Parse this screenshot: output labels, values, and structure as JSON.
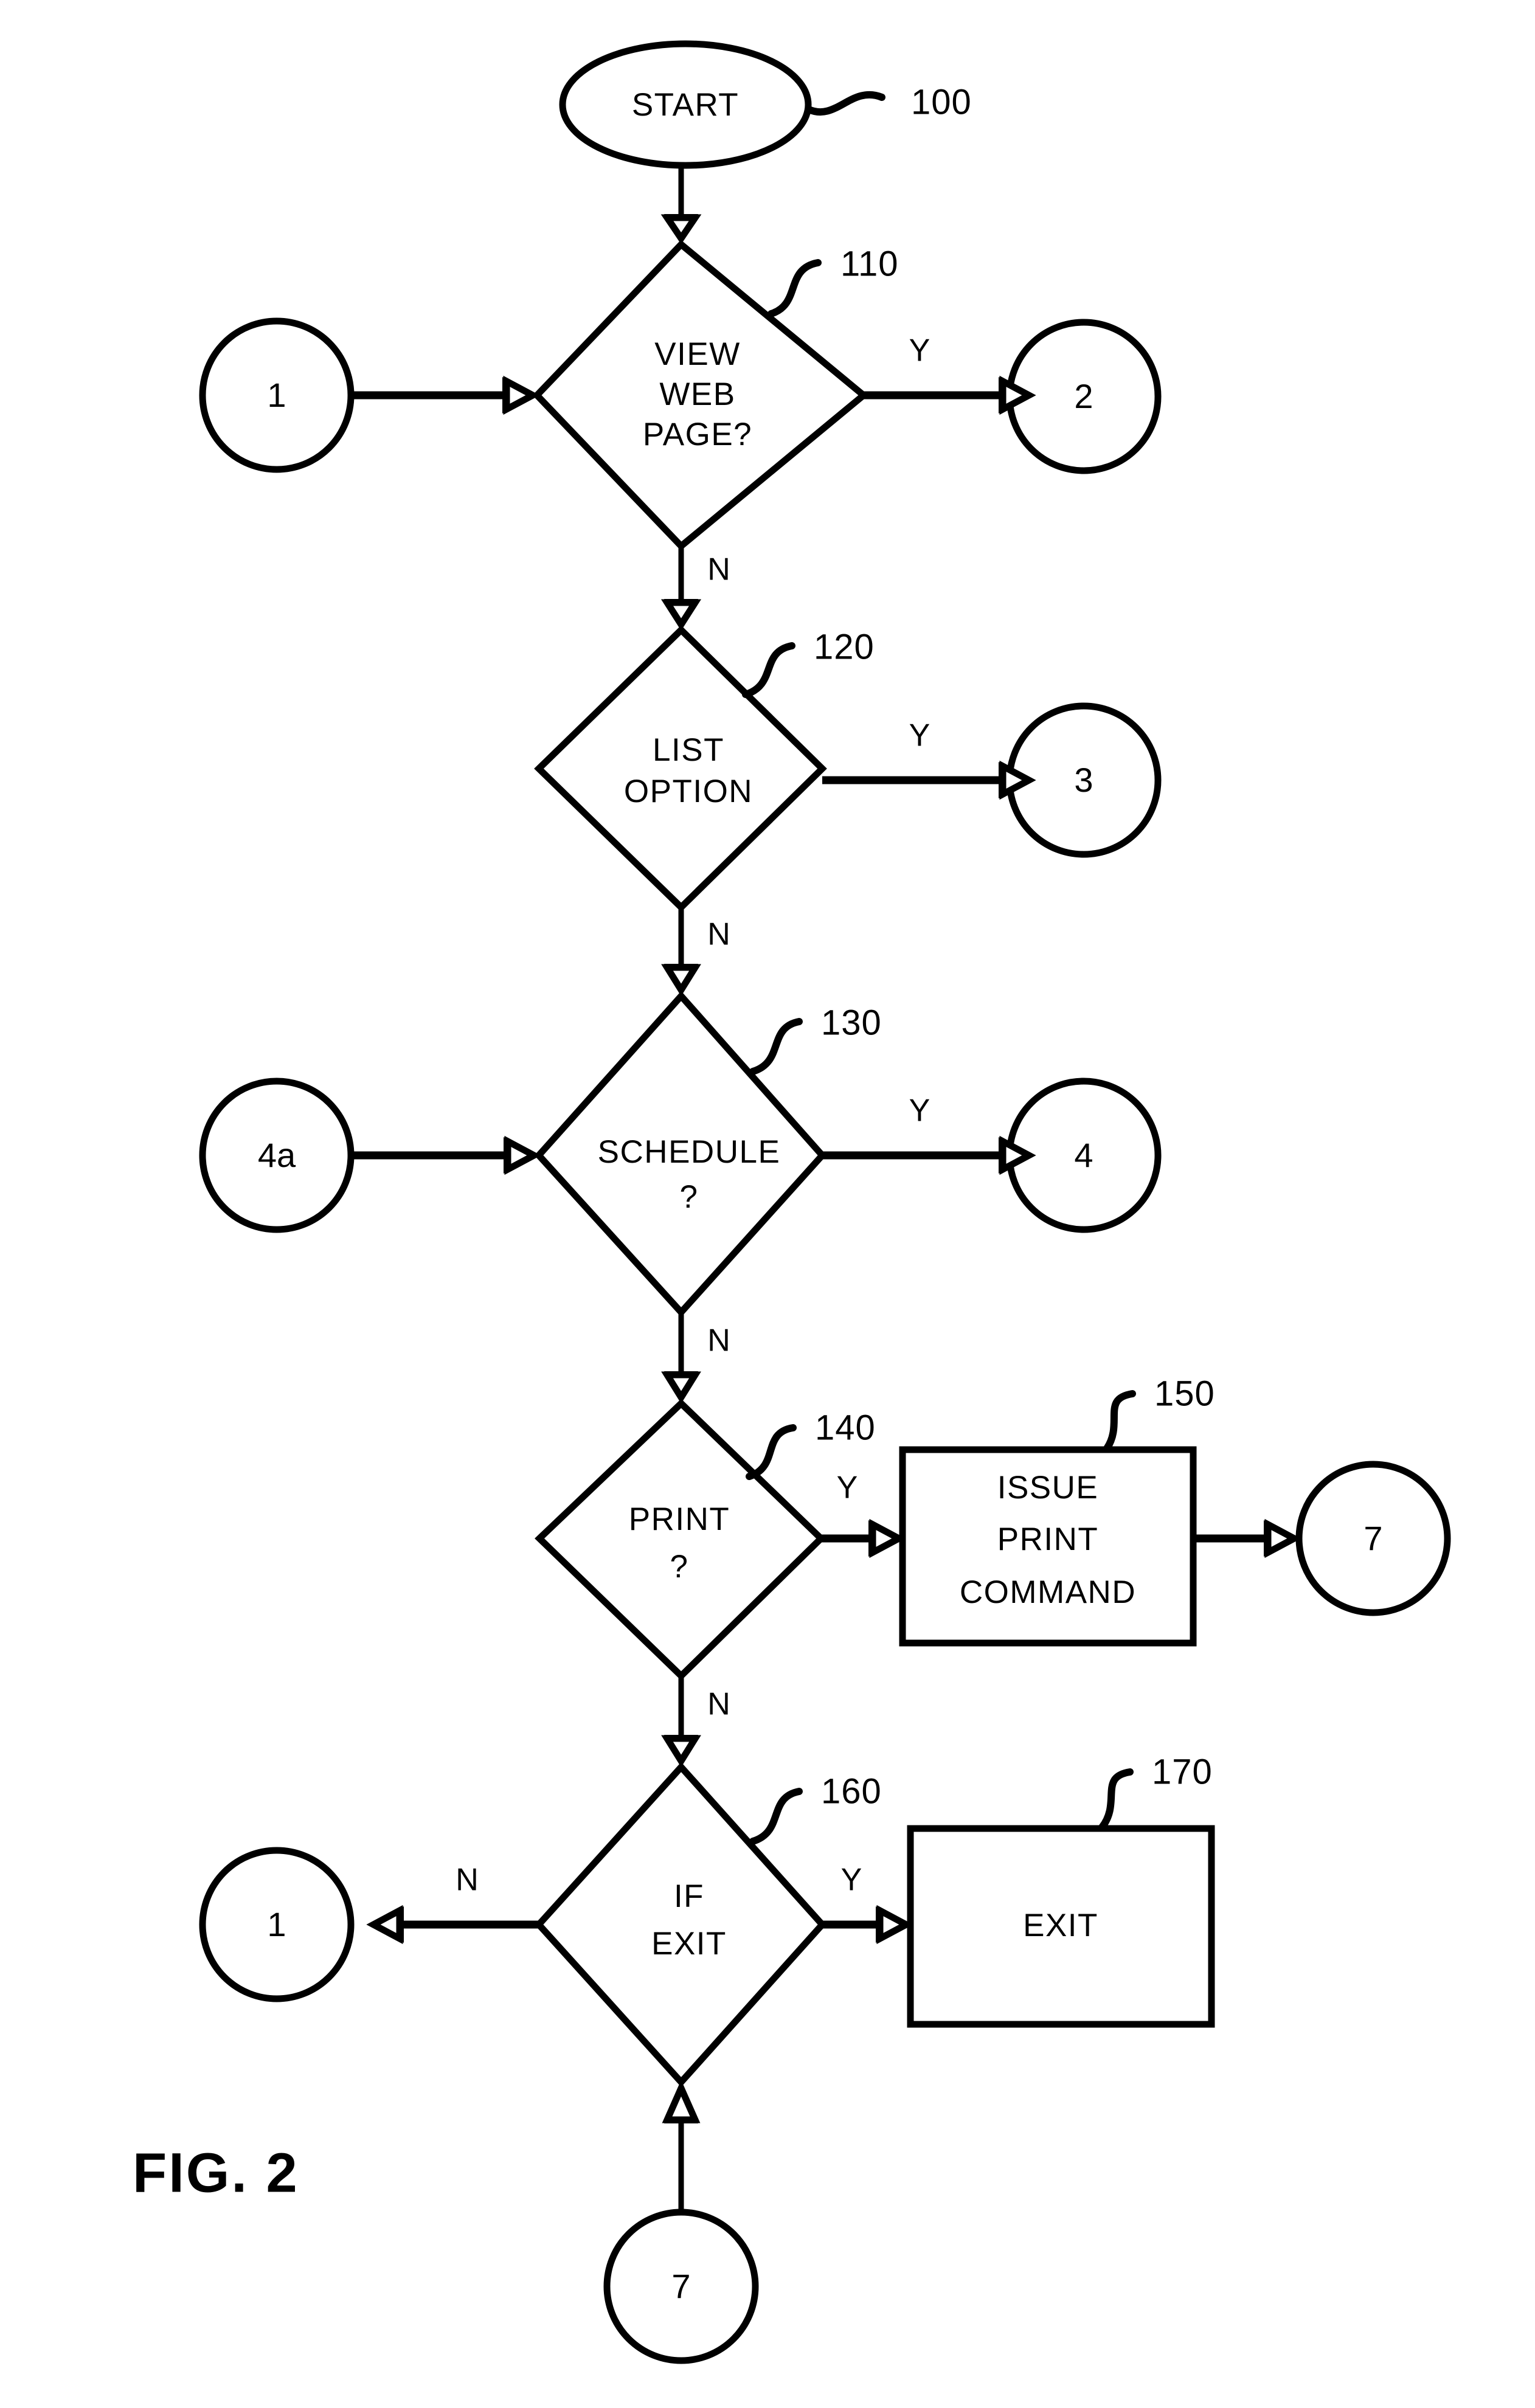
{
  "figure": {
    "caption": "FIG.  2",
    "title": "FIG. 2"
  },
  "nodes": {
    "start": {
      "label": "START",
      "ref": "100",
      "shape": "oval"
    },
    "view_web_page": {
      "label_line1": "VIEW",
      "label_line2": "WEB",
      "label_line3": "PAGE?",
      "ref": "110",
      "shape": "decision"
    },
    "list_option": {
      "label_line1": "LIST",
      "label_line2": "OPTION",
      "ref": "120",
      "shape": "decision"
    },
    "schedule": {
      "label_line1": "SCHEDULE",
      "label_line2": "?",
      "ref": "130",
      "shape": "decision"
    },
    "print": {
      "label_line1": "PRINT",
      "label_line2": "?",
      "ref": "140",
      "shape": "decision"
    },
    "issue_print_command": {
      "label_line1": "ISSUE",
      "label_line2": "PRINT",
      "label_line3": "COMMAND",
      "ref": "150",
      "shape": "process"
    },
    "if_exit": {
      "label_line1": "IF",
      "label_line2": "EXIT",
      "ref": "160",
      "shape": "decision"
    },
    "exit": {
      "label": "EXIT",
      "ref": "170",
      "shape": "process"
    }
  },
  "connectors": {
    "in_1_top": "1",
    "out_2": "2",
    "out_3": "3",
    "in_4a": "4a",
    "out_4": "4",
    "out_7_right": "7",
    "in_1_bottom": "1",
    "in_7_bottom": "7"
  },
  "branch_labels": {
    "view_web_page_yes": "Y",
    "view_web_page_no": "N",
    "list_option_yes": "Y",
    "list_option_no": "N",
    "schedule_yes": "Y",
    "schedule_no": "N",
    "print_yes": "Y",
    "print_no": "N",
    "if_exit_yes": "Y",
    "if_exit_no": "N"
  },
  "colors": {
    "ink": "#000000",
    "paper": "#ffffff"
  }
}
